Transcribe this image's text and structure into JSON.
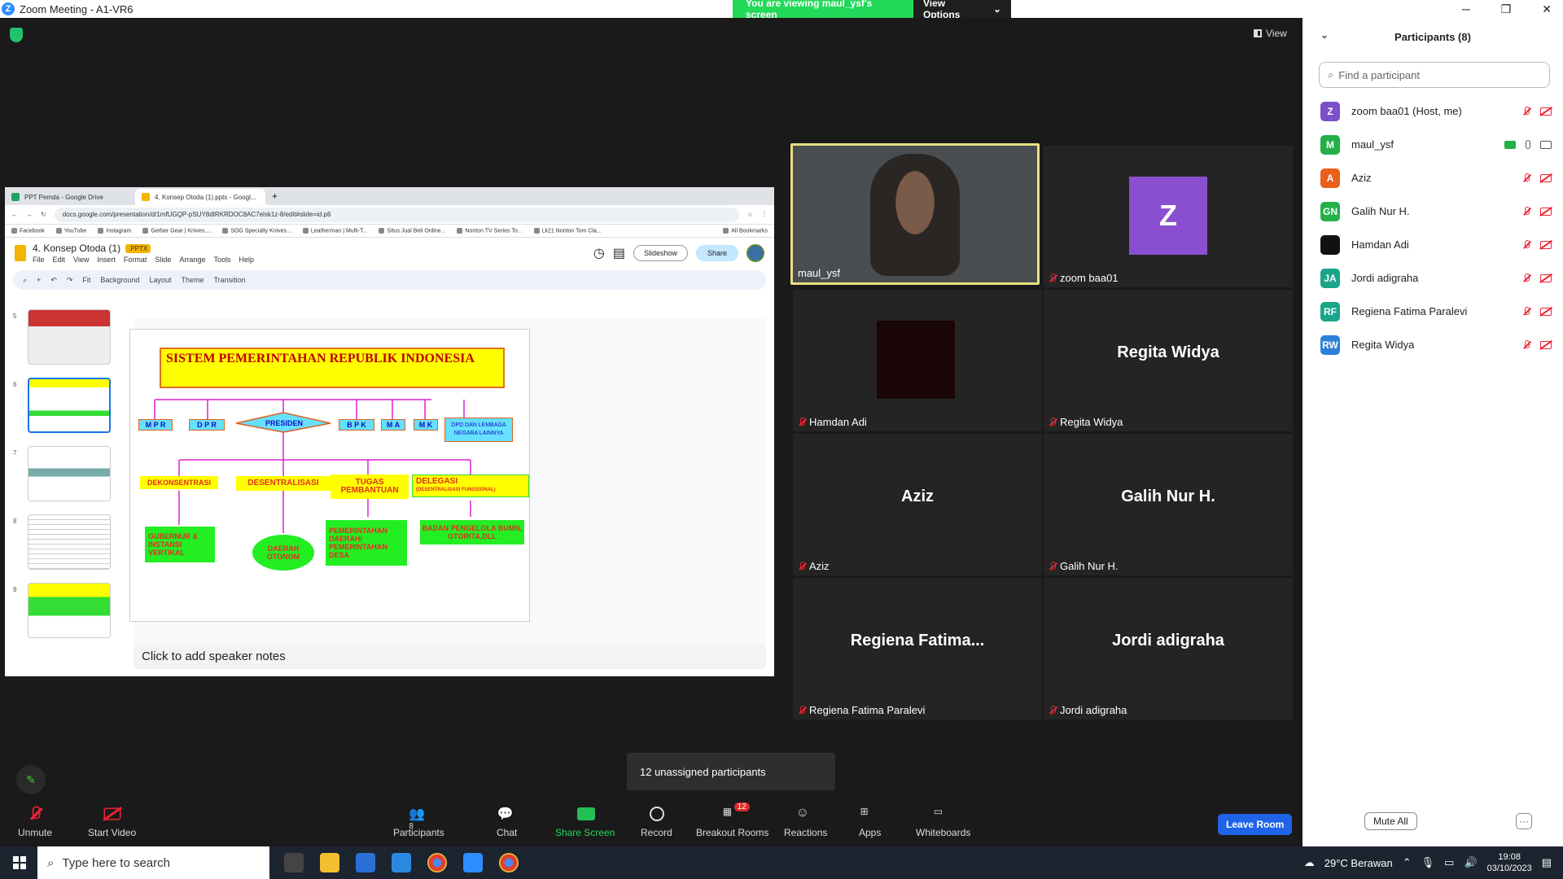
{
  "window": {
    "title": "Zoom Meeting - A1-VR6",
    "logo": "Z"
  },
  "banner": {
    "viewing": "You are viewing maul_ysf's screen",
    "view_options": "View Options"
  },
  "view_button": "View",
  "browser": {
    "tabs": [
      "PPT Pemda - Google Drive",
      "4. Konsep Otoda (1).pptx - Googl..."
    ],
    "url": "docs.google.com/presentation/d/1mfUGQP-pSUY8dtRKRDOC8AC7elsk1z-8/edit#slide=id.p6",
    "bookmarks": [
      "Facebook",
      "YouTube",
      "Instagram",
      "Gerber Gear | Knives,...",
      "SOG Specialty Knives...",
      "Leatherman | Multi-T...",
      "Situs Jual Beli Online...",
      "Nonton TV Series To...",
      "Lk21 Nonton Tom Cla...",
      "All Bookmarks"
    ]
  },
  "slides_app": {
    "filename": "4. Konsep Otoda (1)",
    "badge": ".PPTX",
    "menus": [
      "File",
      "Edit",
      "View",
      "Insert",
      "Format",
      "Slide",
      "Arrange",
      "Tools",
      "Help"
    ],
    "slideshow": "Slideshow",
    "share": "Share",
    "zoom": "Fit",
    "toolbar_items": [
      "Background",
      "Layout",
      "Theme",
      "Transition"
    ],
    "thumb_numbers": [
      "5",
      "6",
      "7",
      "8",
      "9"
    ],
    "speaker_notes": "Click to add speaker notes"
  },
  "slide": {
    "title": "SISTEM PEMERINTAHAN REPUBLIK INDONESIA",
    "top_row": [
      "M P R",
      "D P R",
      "PRESIDEN",
      "B P K",
      "M A",
      "M K",
      "DPD DAN LEMBAGA NEGARA LAINNYA"
    ],
    "mid_row": [
      "DEKONSENTRASI",
      "DESENTRALISASI",
      "TUGAS PEMBANTUAN",
      "DELEGASI"
    ],
    "delegasi_sub": "(DESENTRALISASI FUNGSIONAL)",
    "bottom_row": [
      "GUBERNUR & INSTANSI VERTIKAL",
      "DAERAH OTONOM",
      "PEMERINTAHAN DAERAH/ PEMERINTAHAN DESA",
      "BADAN PENGELOLA BUMN, OTORITA,DLL"
    ]
  },
  "tiles": [
    {
      "name": "maul_ysf",
      "big": ""
    },
    {
      "name": "zoom baa01",
      "big": "Z"
    },
    {
      "name": "Hamdan Adi",
      "big": ""
    },
    {
      "name": "Regita Widya",
      "big": "Regita Widya"
    },
    {
      "name": "Aziz",
      "big": "Aziz"
    },
    {
      "name": "Galih Nur H.",
      "big": "Galih Nur H."
    },
    {
      "name": "Regiena Fatima Paralevi",
      "big": "Regiena  Fatima..."
    },
    {
      "name": "Jordi adigraha",
      "big": "Jordi adigraha"
    }
  ],
  "participants_panel": {
    "title": "Participants (8)",
    "search_placeholder": "Find a participant",
    "list": [
      {
        "initials": "Z",
        "name": "zoom baa01 (Host, me)",
        "color": "#7b4fc8"
      },
      {
        "initials": "M",
        "name": "maul_ysf",
        "color": "#23b048"
      },
      {
        "initials": "A",
        "name": "Aziz",
        "color": "#e8601c"
      },
      {
        "initials": "GN",
        "name": "Galih Nur H.",
        "color": "#23b048"
      },
      {
        "initials": "",
        "name": "Hamdan Adi",
        "color": "#111111"
      },
      {
        "initials": "JA",
        "name": "Jordi adigraha",
        "color": "#1aa58a"
      },
      {
        "initials": "RF",
        "name": "Regiena Fatima Paralevi",
        "color": "#1aa58a"
      },
      {
        "initials": "RW",
        "name": "Regita Widya",
        "color": "#2d7fd8"
      }
    ],
    "mute_all": "Mute All",
    "more": "···"
  },
  "toolbar": {
    "unmute": "Unmute",
    "start_video": "Start Video",
    "participants": "Participants",
    "participants_count": "8",
    "chat": "Chat",
    "share_screen": "Share Screen",
    "record": "Record",
    "breakout": "Breakout Rooms",
    "breakout_badge": "12",
    "reactions": "Reactions",
    "apps": "Apps",
    "whiteboards": "Whiteboards",
    "leave": "Leave Room"
  },
  "unassigned": "12 unassigned participants",
  "taskbar": {
    "search": "Type here to search",
    "weather": "29°C  Berawan",
    "time": "19:08",
    "date": "03/10/2023"
  }
}
